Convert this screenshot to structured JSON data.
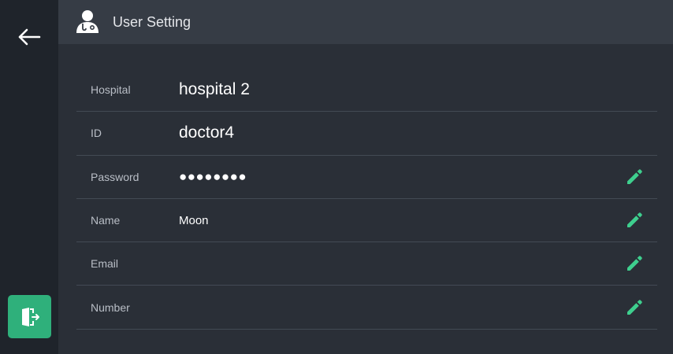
{
  "header": {
    "title": "User Setting"
  },
  "sidebar": {
    "back_icon": "arrow-left-icon",
    "logout_icon": "exit-door-icon"
  },
  "colors": {
    "accent": "#2fb07b",
    "background": "#2a2f37",
    "sidebar": "#1f242b",
    "header": "#363c45"
  },
  "fields": {
    "hospital": {
      "label": "Hospital",
      "value": "hospital 2"
    },
    "id": {
      "label": "ID",
      "value": "doctor4"
    },
    "password": {
      "label": "Password",
      "value": "●●●●●●●●"
    },
    "name": {
      "label": "Name",
      "value": "Moon"
    },
    "email": {
      "label": "Email",
      "value": ""
    },
    "number": {
      "label": "Number",
      "value": ""
    }
  }
}
